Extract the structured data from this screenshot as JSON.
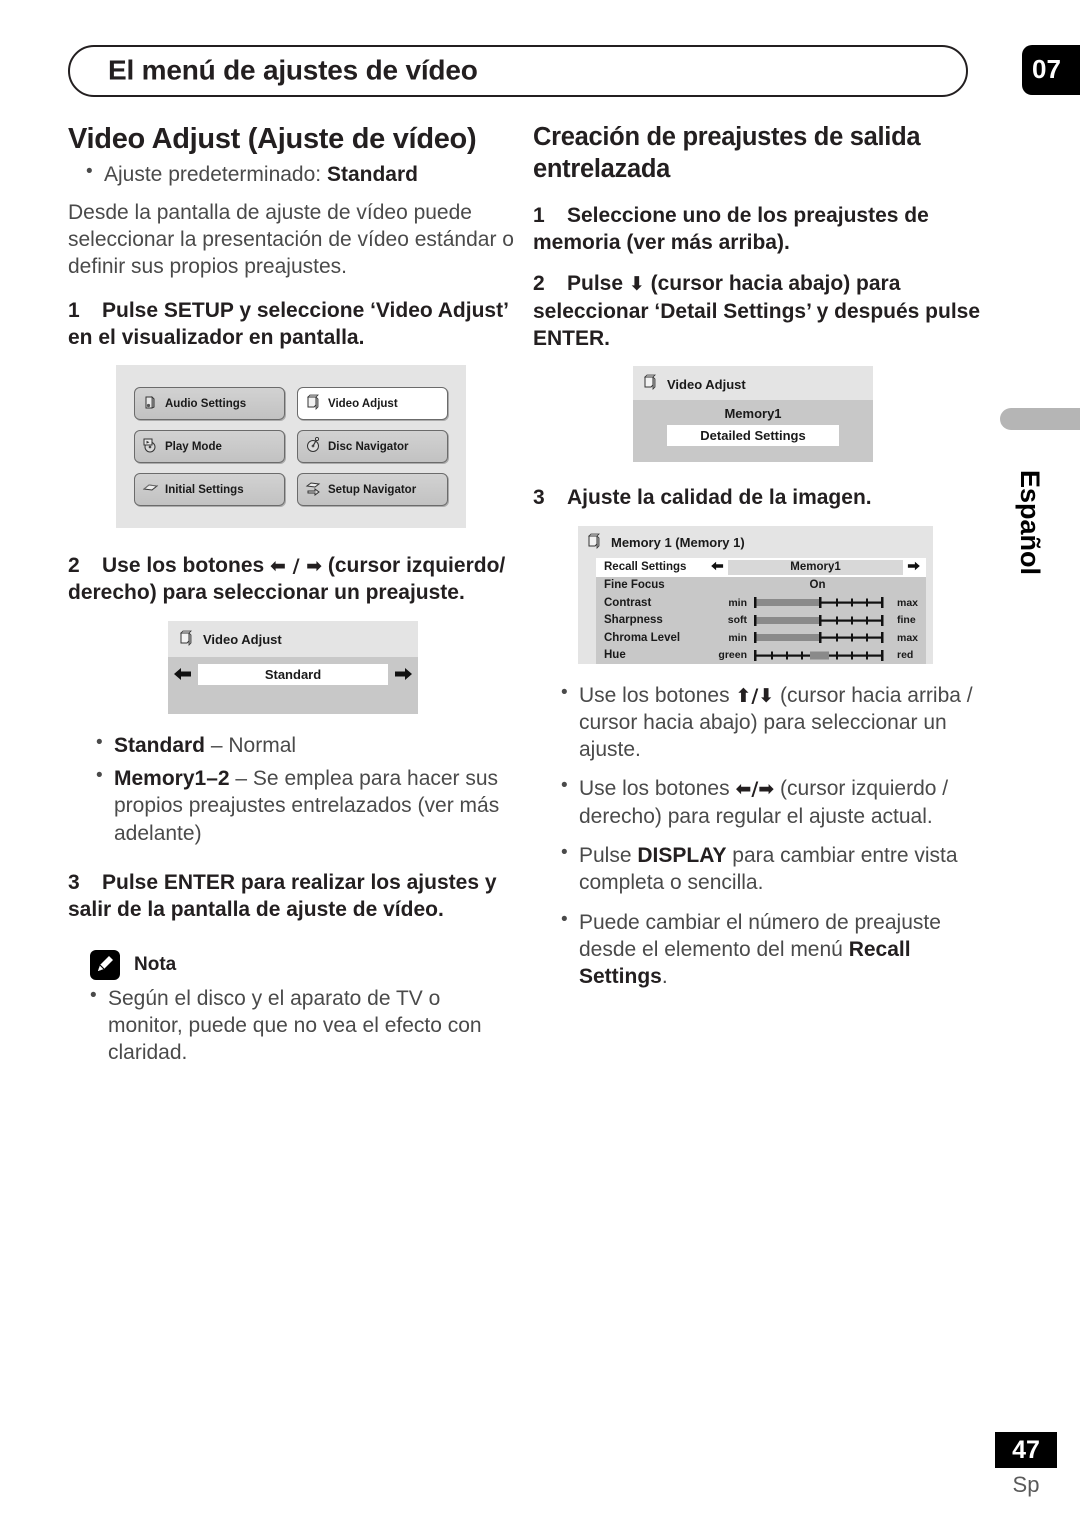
{
  "header": {
    "chapter_title": "El menú de ajustes de vídeo",
    "chapter_number": "07"
  },
  "side_tab": {
    "language": "Español"
  },
  "footer": {
    "page_number": "47",
    "language_code": "Sp"
  },
  "left_column": {
    "heading": "Video Adjust (Ajuste de vídeo)",
    "default_bullet_prefix": "Ajuste predeterminado: ",
    "default_bullet_value": "Standard",
    "intro": "Desde la pantalla de ajuste de vídeo puede seleccionar la presentación de vídeo estándar o definir sus propios preajustes.",
    "step1_num": "1",
    "step1_text": "Pulse SETUP y seleccione ‘Video Adjust’ en el visualizador en pantalla.",
    "step2_num": "2",
    "step2_text_a": "Use los botones ",
    "step2_arrows": "⬅ / ➡",
    "step2_text_b": " (cursor izquierdo/ derecho) para seleccionar un preajuste.",
    "preset_bullets": [
      {
        "name": "Standard",
        "dash": " – ",
        "desc": "Normal"
      },
      {
        "name": "Memory1–2",
        "dash": " – ",
        "desc": "Se emplea para hacer sus propios preajustes entrelazados (ver más adelante)"
      }
    ],
    "step3_num": "3",
    "step3_text": "Pulse ENTER para realizar los ajustes y salir de la pantalla de ajuste de vídeo.",
    "note": {
      "label": "Nota",
      "icon": "pencil-icon",
      "text": "Según el disco y el aparato de TV o monitor, puede que no vea el efecto con claridad."
    },
    "menu_graphic": {
      "items": [
        {
          "label": "Audio Settings",
          "icon": "audio-icon",
          "selected": false
        },
        {
          "label": "Video Adjust",
          "icon": "video-icon",
          "selected": true
        },
        {
          "label": "Play Mode",
          "icon": "play-mode-icon",
          "selected": false
        },
        {
          "label": "Disc Navigator",
          "icon": "disc-icon",
          "selected": false
        },
        {
          "label": "Initial Settings",
          "icon": "initial-settings-icon",
          "selected": false
        },
        {
          "label": "Setup Navigator",
          "icon": "setup-navigator-icon",
          "selected": false
        }
      ]
    },
    "video_adjust_graphic": {
      "title": "Video Adjust",
      "icon": "video-icon",
      "value": "Standard",
      "left_arrow": "arrow-left-icon",
      "right_arrow": "arrow-right-icon"
    }
  },
  "right_column": {
    "heading": "Creación de preajustes de salida entrelazada",
    "step1_num": "1",
    "step1_text": "Seleccione uno de los preajustes de memoria (ver más arriba).",
    "step2_num": "2",
    "step2_text_a": "Pulse ",
    "step2_arrow": "⬇",
    "step2_text_b": " (cursor hacia abajo) para seleccionar ‘Detail Settings’ y después pulse ENTER.",
    "step3_num": "3",
    "step3_text": "Ajuste la calidad de la imagen.",
    "memory_graphic": {
      "title": "Video Adjust",
      "icon": "video-icon",
      "memory_label": "Memory1",
      "value": "Detailed Settings"
    },
    "detail_graphic": {
      "title": "Memory 1 (Memory 1)",
      "icon": "video-icon",
      "rows": [
        {
          "label": "Recall Settings",
          "type": "selector",
          "value": "Memory1",
          "highlighted": true
        },
        {
          "label": "Fine Focus",
          "type": "value",
          "value": "On",
          "highlighted": false
        },
        {
          "label": "Contrast",
          "type": "slider",
          "min_label": "min",
          "max_label": "max",
          "fill": 0.5,
          "highlighted": false
        },
        {
          "label": "Sharpness",
          "type": "slider",
          "min_label": "soft",
          "max_label": "fine",
          "fill": 0.5,
          "highlighted": false
        },
        {
          "label": "Chroma Level",
          "type": "slider",
          "min_label": "min",
          "max_label": "max",
          "fill": 0.5,
          "highlighted": false
        },
        {
          "label": "Hue",
          "type": "centered",
          "min_label": "green",
          "max_label": "red",
          "position": 0.5,
          "highlighted": false
        }
      ]
    },
    "bullets": [
      {
        "pre": "Use los botones ",
        "arrows": "⬆/⬇",
        "post": " (cursor hacia arriba / cursor hacia abajo) para seleccionar un ajuste.",
        "bold": ""
      },
      {
        "pre": "Use los botones ",
        "arrows": "⬅/➡",
        "post": " (cursor izquierdo / derecho) para regular el ajuste actual.",
        "bold": ""
      },
      {
        "pre": "Pulse ",
        "arrows": "",
        "bold": "DISPLAY",
        "post": " para cambiar entre vista completa o sencilla."
      },
      {
        "pre": "Puede cambiar el número de preajuste desde el elemento del menú ",
        "arrows": "",
        "bold": "Recall Settings",
        "post": "."
      }
    ]
  },
  "colors": {
    "panel_bg": "#e4e4e4",
    "strip_bg": "#c8c8c8",
    "highlight": "#ffffff",
    "text": "#231f20",
    "body_text": "#4a4a4a",
    "black": "#000000"
  }
}
